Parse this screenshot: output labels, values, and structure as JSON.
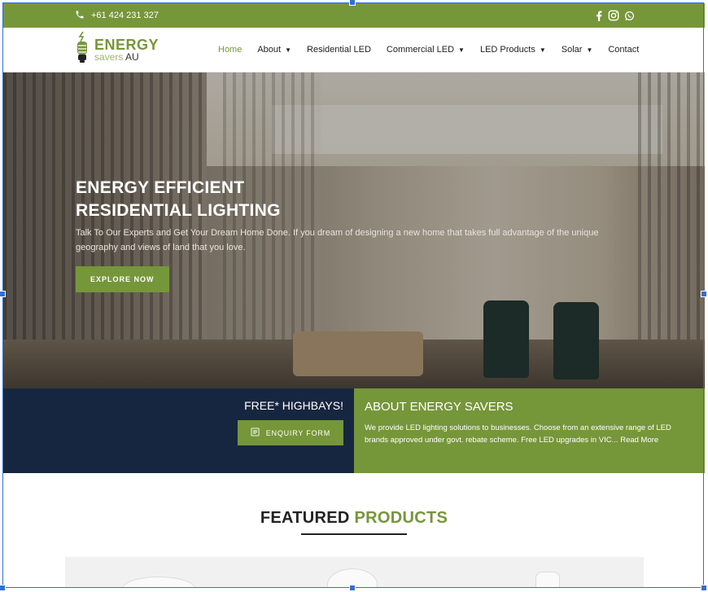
{
  "topbar": {
    "phone": "+61 424 231 327",
    "icons": [
      "phone-icon",
      "facebook-icon",
      "instagram-icon",
      "whatsapp-icon"
    ]
  },
  "logo": {
    "main": "ENERGY",
    "sub": "savers",
    "sub_suffix": "AU"
  },
  "nav": {
    "items": [
      {
        "label": "Home",
        "active": true,
        "dropdown": false
      },
      {
        "label": "About",
        "active": false,
        "dropdown": true
      },
      {
        "label": "Residential LED",
        "active": false,
        "dropdown": false
      },
      {
        "label": "Commercial LED",
        "active": false,
        "dropdown": true
      },
      {
        "label": "LED Products",
        "active": false,
        "dropdown": true
      },
      {
        "label": "Solar",
        "active": false,
        "dropdown": true
      },
      {
        "label": "Contact",
        "active": false,
        "dropdown": false
      }
    ]
  },
  "hero": {
    "title_line1": "ENERGY EFFICIENT",
    "title_line2": "RESIDENTIAL LIGHTING",
    "description": "Talk To Our Experts and Get Your Dream Home Done. If you dream of designing a new home that takes full advantage of the unique geography and views of land that you love.",
    "button": "EXPLORE NOW"
  },
  "banner": {
    "free_title": "FREE* HIGHBAYS!",
    "enquiry_button": "ENQUIRY FORM",
    "about_title": "ABOUT ENERGY SAVERS",
    "about_text": "We provide LED lighting solutions to businesses. Choose from an extensive range of LED brands approved under govt. rebate scheme. Free LED upgrades in VIC... Read More"
  },
  "featured": {
    "title_dark": "FEATURED",
    "title_green": "PRODUCTS"
  },
  "colors": {
    "brand_green": "#76963a",
    "navy": "#172640"
  }
}
